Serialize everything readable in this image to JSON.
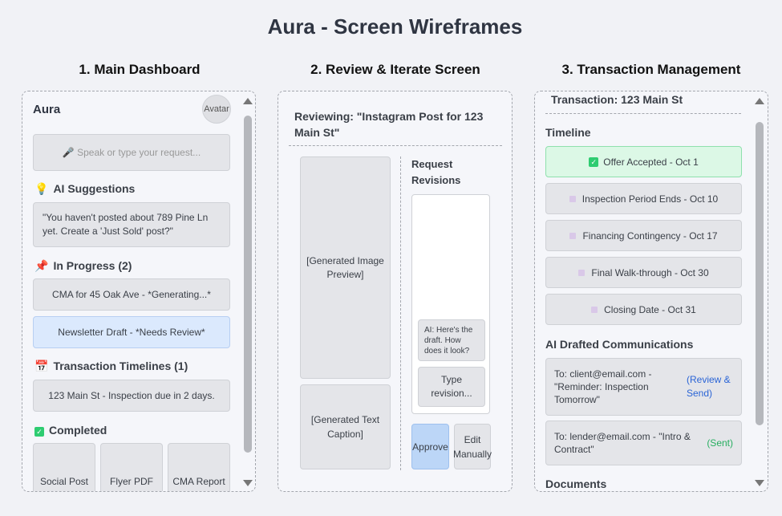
{
  "title": "Aura - Screen Wireframes",
  "columns": {
    "dashboard": "1. Main Dashboard",
    "review": "2. Review & Iterate Screen",
    "transaction": "3. Transaction Management"
  },
  "dashboard": {
    "app_name": "Aura",
    "avatar": "Avatar",
    "input_placeholder": "🎤 Speak or type your request...",
    "ai_suggestions": {
      "heading": "AI Suggestions",
      "icon": "lightbulb-icon",
      "text": "\"You haven't posted about 789 Pine Ln yet. Create a 'Just Sold' post?\""
    },
    "in_progress": {
      "heading": "In Progress (2)",
      "icon": "pin-icon",
      "items": [
        "CMA for 45 Oak Ave - *Generating...*",
        "Newsletter Draft - *Needs Review*"
      ]
    },
    "timelines": {
      "heading": "Transaction Timelines (1)",
      "icon": "calendar-icon",
      "item": "123 Main St - Inspection due in 2 days."
    },
    "completed": {
      "heading": "Completed",
      "icon": "check-icon",
      "items": [
        "Social Post",
        "Flyer PDF",
        "CMA Report"
      ]
    }
  },
  "review": {
    "heading": "Reviewing: \"Instagram Post for 123 Main St\"",
    "image_preview": "[Generated Image Preview]",
    "text_caption": "[Generated Text Caption]",
    "revisions_heading": "Request Revisions",
    "ai_message": "AI: Here's the draft. How does it look?",
    "revision_input": "Type revision...",
    "approve": "Approve",
    "edit_manually": "Edit Manually"
  },
  "transaction": {
    "heading": "Transaction: 123 Main St",
    "timeline_heading": "Timeline",
    "timeline": [
      "Offer Accepted - Oct 1",
      "Inspection Period Ends - Oct 10",
      "Financing Contingency - Oct 17",
      "Final Walk-through - Oct 30",
      "Closing Date - Oct 31"
    ],
    "comms_heading": "AI Drafted Communications",
    "comms": [
      {
        "text": "To: client@email.com - \"Reminder: Inspection Tomorrow\"",
        "action": "(Review & Send)"
      },
      {
        "text": "To: lender@email.com - \"Intro & Contract\"",
        "action": "(Sent)"
      }
    ],
    "documents_heading": "Documents"
  },
  "colors": {
    "accent_blue": "#2a64d6",
    "sent_green": "#27ae60",
    "success_bg": "#dcf8e6",
    "highlight_bg": "#dbe9fd",
    "approve_bg": "#bcd6f7"
  }
}
